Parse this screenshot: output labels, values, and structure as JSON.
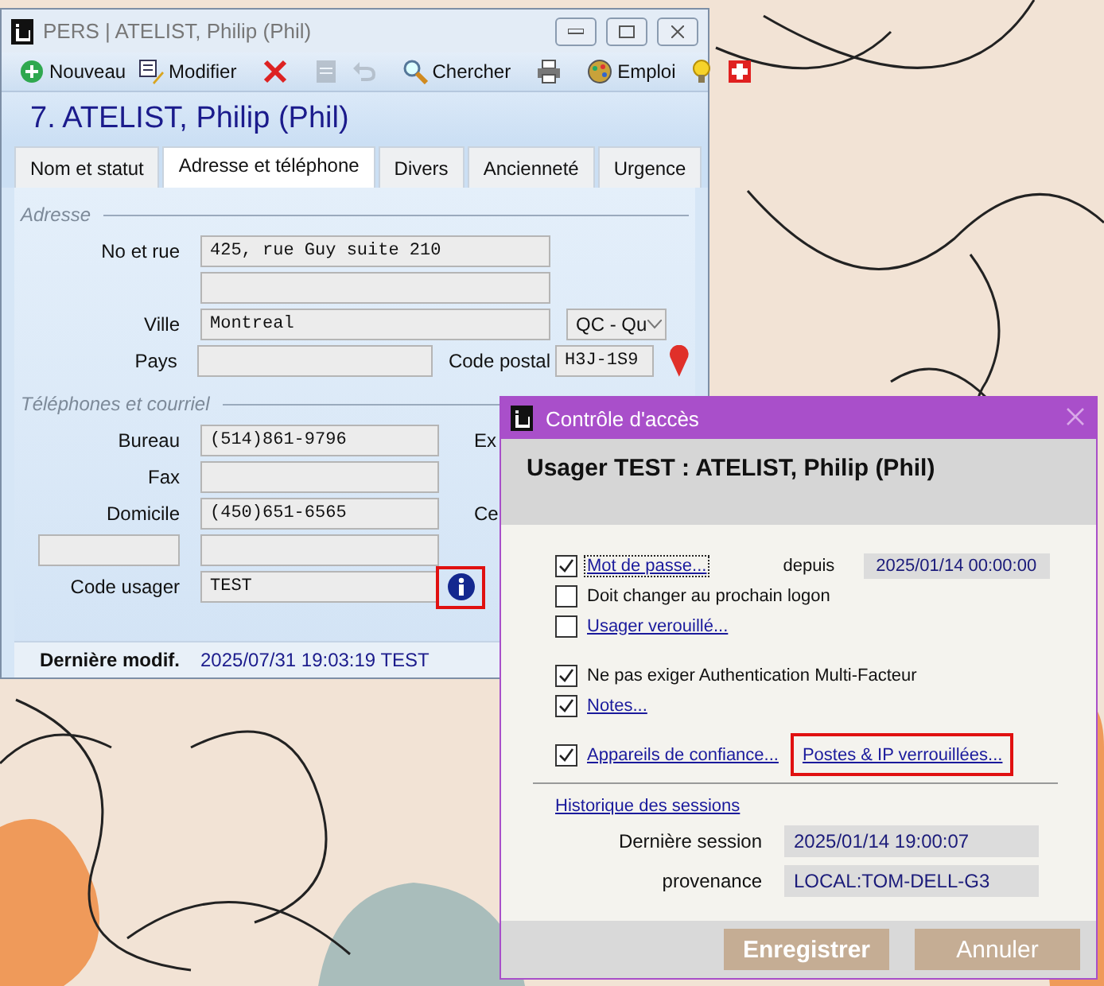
{
  "main_window": {
    "title": "PERS | ATELIST, Philip (Phil)",
    "toolbar_groups": [
      [
        {
          "kind": "add",
          "label": "Nouveau",
          "disabled": false
        },
        {
          "kind": "edit",
          "label": "Modifier",
          "disabled": false
        }
      ],
      [
        {
          "kind": "delete",
          "disabled": false
        }
      ],
      [
        {
          "kind": "save",
          "disabled": true
        },
        {
          "kind": "undo",
          "disabled": true
        }
      ],
      [
        {
          "kind": "search",
          "label": "Chercher",
          "disabled": false
        }
      ],
      [
        {
          "kind": "print",
          "disabled": false
        }
      ],
      [
        {
          "kind": "job",
          "label": "Emploi",
          "disabled": false
        },
        {
          "kind": "tip",
          "disabled": false
        },
        {
          "kind": "flag",
          "disabled": false
        }
      ]
    ],
    "heading": "7. ATELIST, Philip (Phil)",
    "tabs": [
      {
        "label": "Nom et statut",
        "selected": false
      },
      {
        "label": "Adresse et téléphone",
        "selected": true
      },
      {
        "label": "Divers",
        "selected": false
      },
      {
        "label": "Ancienneté",
        "selected": false
      },
      {
        "label": "Urgence",
        "selected": false
      }
    ],
    "address": {
      "title": "Adresse",
      "street_label": "No et rue",
      "street": "425, rue Guy suite 210",
      "city_label": "Ville",
      "city": "Montreal",
      "province": "QC - Qu",
      "country_label": "Pays",
      "postal_label": "Code postal",
      "postal": "H3J-1S9"
    },
    "phones": {
      "title": "Téléphones et courriel",
      "rows": [
        {
          "kind": "labeled",
          "label": "Bureau",
          "value": "(514)861-9796",
          "side_label": "Ex"
        },
        {
          "kind": "labeled",
          "label": "Fax"
        },
        {
          "kind": "labeled",
          "label": "Domicile",
          "value": "(450)651-6565",
          "side_label": "Ce"
        },
        {
          "kind": "custom"
        }
      ]
    },
    "user_code": {
      "label": "Code usager",
      "value": "TEST",
      "info_highlighted": true
    },
    "footer": {
      "label": "Dernière modif.",
      "value": "2025/07/31 19:03:19 TEST"
    }
  },
  "dialog": {
    "title": "Contrôle d'accès",
    "heading": "Usager TEST : ATELIST, Philip (Phil)",
    "since_label": "depuis",
    "since": "2025/01/14 00:00:00",
    "option_groups": [
      [
        {
          "kind": "link",
          "label": "Mot de passe...",
          "checked": true,
          "focused": true
        },
        {
          "kind": "text",
          "label": "Doit changer au prochain logon",
          "checked": false,
          "focused": false
        },
        {
          "kind": "link",
          "label": "Usager verouillé...",
          "checked": false,
          "focused": false
        }
      ],
      [
        {
          "kind": "text",
          "label": "Ne pas exiger Authentication Multi-Facteur",
          "checked": true,
          "focused": false
        },
        {
          "kind": "link",
          "label": "Notes...",
          "checked": true,
          "focused": false
        }
      ],
      [
        {
          "kind": "link",
          "label": "Appareils de confiance...",
          "checked": true,
          "focused": false
        }
      ]
    ],
    "extra_link": {
      "label": "Postes & IP verrouillées...",
      "highlighted": true
    },
    "history_link": "Historique des sessions",
    "last_session_label": "Dernière session",
    "last_session": "2025/01/14 19:00:07",
    "origin_label": "provenance",
    "origin": "LOCAL:TOM-DELL-G3",
    "buttons": [
      {
        "kind": "primary",
        "label": "Enregistrer"
      },
      {
        "kind": "secondary",
        "label": "Annuler"
      }
    ]
  }
}
